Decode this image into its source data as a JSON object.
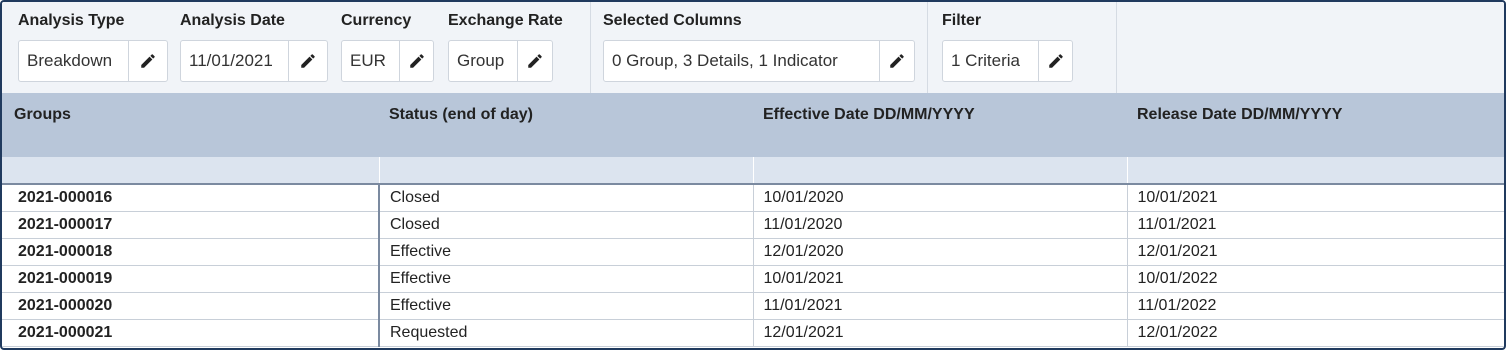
{
  "toolbar": {
    "analysis_type": {
      "label": "Analysis Type",
      "value": "Breakdown"
    },
    "analysis_date": {
      "label": "Analysis Date",
      "value": "11/01/2021"
    },
    "currency": {
      "label": "Currency",
      "value": "EUR"
    },
    "exchange_rate": {
      "label": "Exchange Rate",
      "value": "Group"
    },
    "selected_columns": {
      "label": "Selected Columns",
      "value": "0 Group, 3 Details, 1 Indicator"
    },
    "filter": {
      "label": "Filter",
      "value": "1 Criteria"
    },
    "edit_icon": "pencil-icon"
  },
  "table": {
    "columns": [
      "Groups",
      "Status (end of day)",
      "Effective Date DD/MM/YYYY",
      "Release Date DD/MM/YYYY"
    ],
    "rows": [
      [
        "2021-000016",
        "Closed",
        "10/01/2020",
        "10/01/2021"
      ],
      [
        "2021-000017",
        "Closed",
        "11/01/2020",
        "11/01/2021"
      ],
      [
        "2021-000018",
        "Effective",
        "12/01/2020",
        "12/01/2021"
      ],
      [
        "2021-000019",
        "Effective",
        "10/01/2021",
        "10/01/2022"
      ],
      [
        "2021-000020",
        "Effective",
        "11/01/2021",
        "11/01/2022"
      ],
      [
        "2021-000021",
        "Requested",
        "12/01/2021",
        "12/01/2022"
      ]
    ]
  },
  "colors": {
    "header_bg": "#b8c6d9",
    "filter_row_bg": "#dce4ef",
    "toolbar_bg": "#f1f4f8",
    "frame_border": "#203a5e"
  }
}
